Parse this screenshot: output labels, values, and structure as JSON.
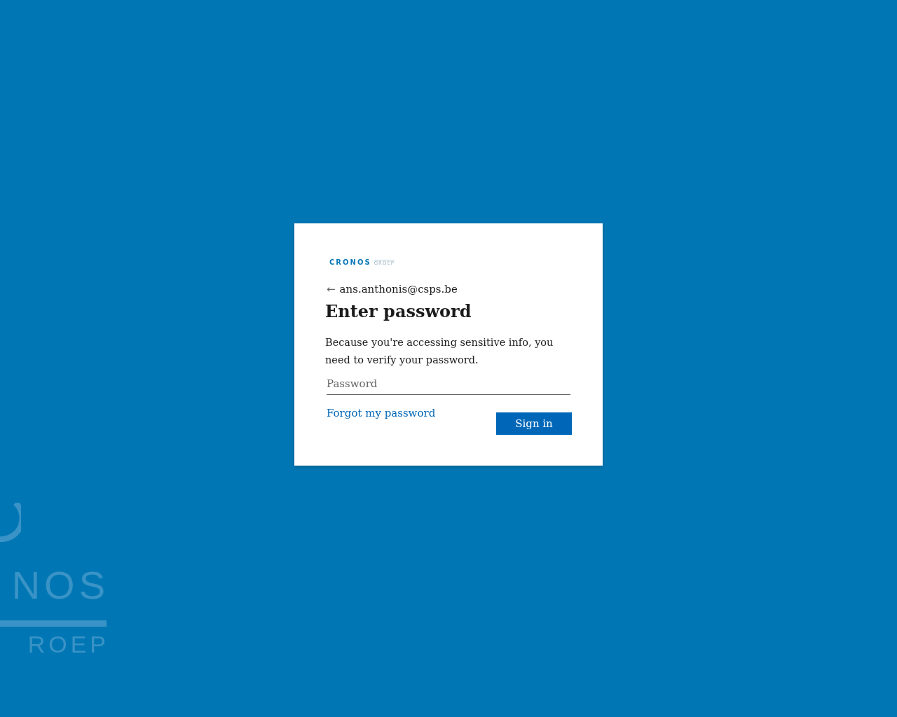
{
  "background_logo": {
    "word": "NOS",
    "subword": "ROEP"
  },
  "card": {
    "logo": {
      "word": "CRONOS",
      "subword": "GROEP"
    },
    "back": {
      "arrow": "←",
      "account": "ans.anthonis@csps.be"
    },
    "title": "Enter password",
    "description": "Because you're accessing sensitive info, you need to verify your password.",
    "password": {
      "placeholder": "Password"
    },
    "forgot_link": "Forgot my password",
    "sign_in_button": "Sign in"
  }
}
